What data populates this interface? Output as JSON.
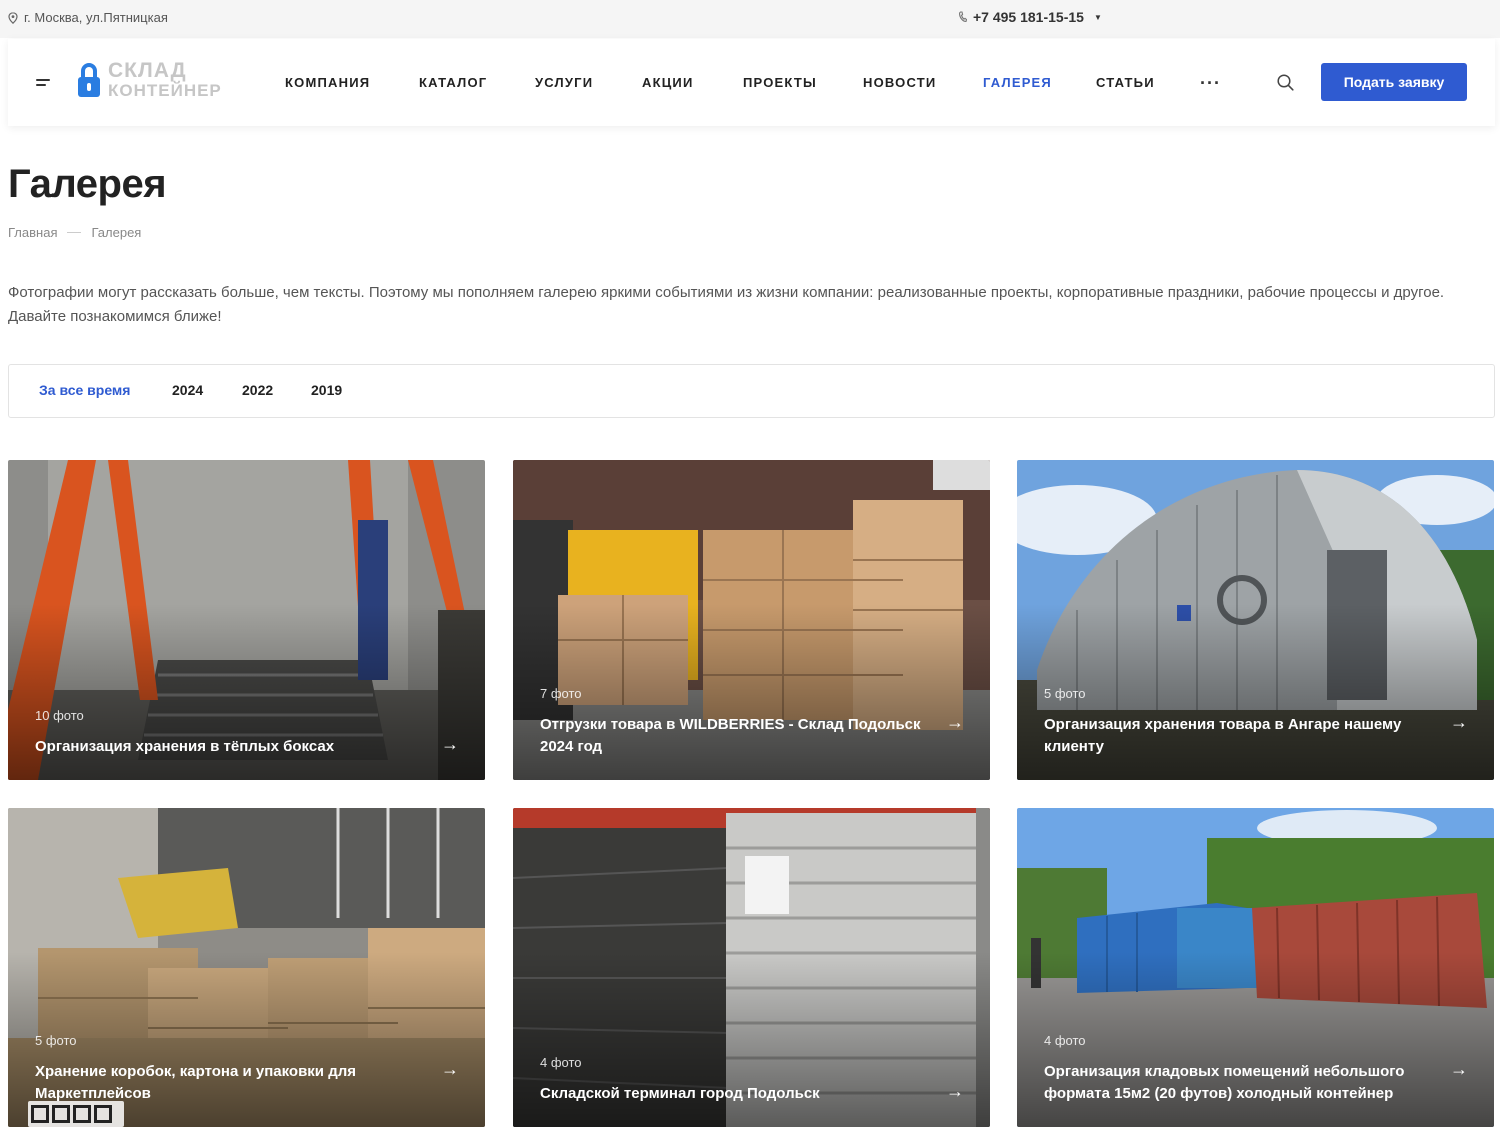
{
  "topbar": {
    "address": "г. Москва, ул.Пятницкая",
    "phone": "+7 495 181-15-15"
  },
  "header": {
    "logo_line1": "СКЛАД",
    "logo_line2": "КОНТЕЙНЕР",
    "nav": [
      {
        "label": "КОМПАНИЯ"
      },
      {
        "label": "КАТАЛОГ"
      },
      {
        "label": "УСЛУГИ"
      },
      {
        "label": "АКЦИИ"
      },
      {
        "label": "ПРОЕКТЫ"
      },
      {
        "label": "НОВОСТИ"
      },
      {
        "label": "ГАЛЕРЕЯ",
        "active": true
      },
      {
        "label": "СТАТЬИ"
      }
    ],
    "more": "···",
    "cta_label": "Подать заявку"
  },
  "page": {
    "title": "Галерея",
    "breadcrumb": [
      "Главная",
      "Галерея"
    ],
    "intro": "Фотографии могут рассказать больше, чем тексты. Поэтому мы пополняем галерею яркими событиями из жизни компании: реализованные проекты, корпоративные праздники, рабочие процессы и другое. Давайте познакомимся ближе!"
  },
  "filters": [
    {
      "label": "За все время",
      "active": true
    },
    {
      "label": "2024"
    },
    {
      "label": "2022"
    },
    {
      "label": "2019"
    }
  ],
  "cards": [
    {
      "count": "10 фото",
      "title": "Организация хранения в тёплых боксах"
    },
    {
      "count": "7 фото",
      "title": "Отгрузки товара в WILDBERRIES - Склад Подольск 2024 год"
    },
    {
      "count": "5 фото",
      "title": "Организация хранения товара в Ангаре нашему клиенту"
    },
    {
      "count": "5 фото",
      "title": "Хранение коробок, картона и упаковки для Маркетплейсов"
    },
    {
      "count": "4 фото",
      "title": "Складской терминал город Подольск"
    },
    {
      "count": "4 фото",
      "title": "Организация кладовых помещений небольшого формата 15м2 (20 футов) холодный контейнер"
    }
  ],
  "icons": {
    "location": "location-pin-icon",
    "phone": "phone-icon",
    "search": "search-icon",
    "arrow": "→"
  },
  "colors": {
    "accent": "#2f5bd1",
    "logo_blue": "#2a7de1"
  }
}
